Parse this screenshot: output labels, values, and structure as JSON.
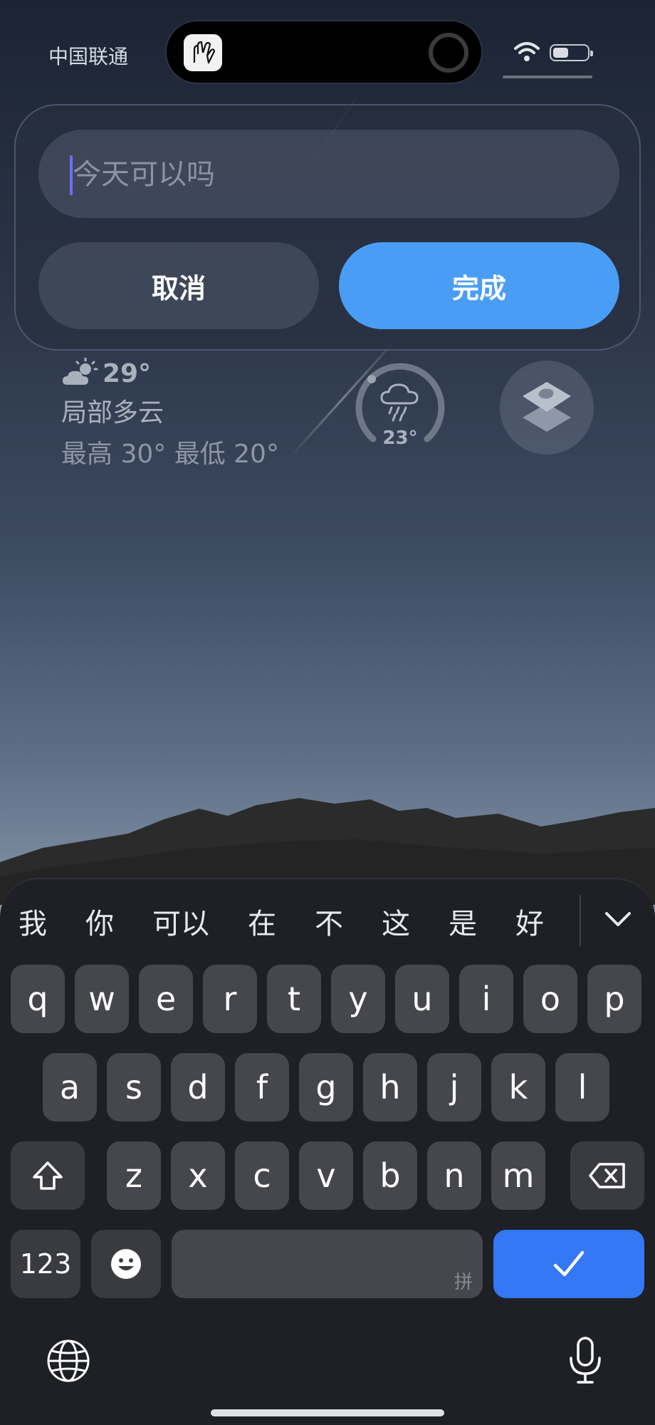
{
  "status_bar": {
    "carrier": "中国联通",
    "battery_level": 0.45
  },
  "edit_panel": {
    "text_value": "今天可以吗",
    "cancel_label": "取消",
    "done_label": "完成"
  },
  "weather_widget": {
    "temperature": "29°",
    "condition": "局部多云",
    "high_low": "最高 30° 最低 20°"
  },
  "rain_widget": {
    "temperature": "23°"
  },
  "keyboard": {
    "candidates": [
      "我",
      "你",
      "可以",
      "在",
      "不",
      "这",
      "是",
      "好"
    ],
    "row1": [
      "q",
      "w",
      "e",
      "r",
      "t",
      "y",
      "u",
      "i",
      "o",
      "p"
    ],
    "row2": [
      "a",
      "s",
      "d",
      "f",
      "g",
      "h",
      "j",
      "k",
      "l"
    ],
    "row3": [
      "z",
      "x",
      "c",
      "v",
      "b",
      "n",
      "m"
    ],
    "numbers_label": "123",
    "space_hint": "拼"
  },
  "colors": {
    "done_button": "#4a9df5",
    "confirm_key": "#3478f6",
    "caret": "#6d6cff"
  }
}
